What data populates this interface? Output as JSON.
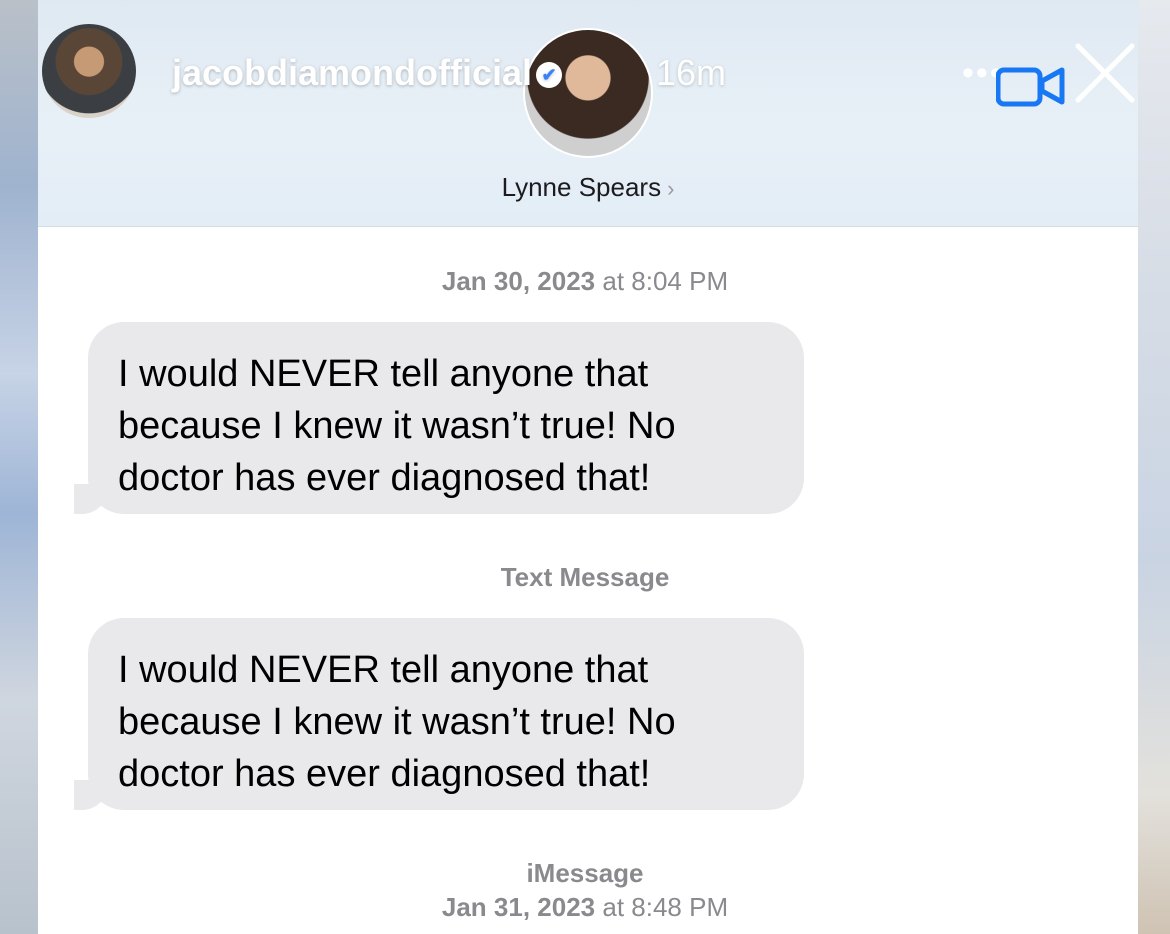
{
  "story": {
    "username": "jacobdiamondofficial",
    "time": "16m",
    "more": "•••"
  },
  "contact": {
    "name": "Lynne Spears",
    "chevron": "›"
  },
  "messages": [
    {
      "timestamp_date": "Jan 30, 2023",
      "timestamp_at": "at",
      "timestamp_time": "8:04 PM",
      "text": "I would NEVER tell anyone that because I knew it wasn’t true! No doctor has ever diagnosed that!"
    },
    {
      "label": "Text Message",
      "text": "I would NEVER tell anyone that because I knew it wasn’t true! No doctor has ever diagnosed that!"
    }
  ],
  "footer": {
    "service": "iMessage",
    "timestamp_date": "Jan 31, 2023",
    "timestamp_at": "at",
    "timestamp_time": "8:48 PM"
  },
  "colors": {
    "bubble": "#e9e9eb",
    "accent": "#1877f2",
    "meta_text": "#8a8a8e"
  },
  "icons": [
    "verified-badge-icon",
    "video-camera-icon",
    "close-icon",
    "chevron-right-icon"
  ]
}
